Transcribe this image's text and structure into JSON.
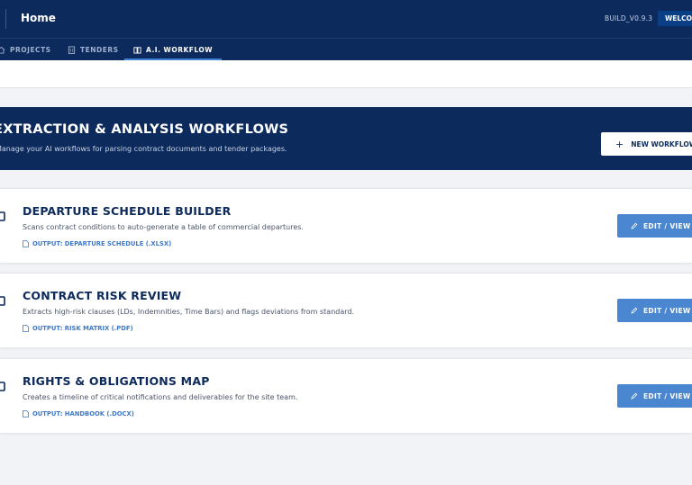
{
  "header": {
    "title": "Home",
    "build": "BUILD_V0.9.3",
    "welcome": "WELCOME"
  },
  "nav": {
    "tabs": [
      {
        "label": "PROJECTS",
        "icon": "home-icon",
        "active": false
      },
      {
        "label": "TENDERS",
        "icon": "building-icon",
        "active": false
      },
      {
        "label": "A.I. WORKFLOW",
        "icon": "book-icon",
        "active": true
      }
    ]
  },
  "hero": {
    "title": "EXTRACTION & ANALYSIS WORKFLOWS",
    "subtitle": "Manage your AI workflows for parsing contract documents and tender packages.",
    "new_button": "NEW WORKFLOW"
  },
  "workflows": [
    {
      "title": "DEPARTURE SCHEDULE BUILDER",
      "description": "Scans contract conditions to auto-generate a table of commercial departures.",
      "output": "OUTPUT: DEPARTURE SCHEDULE (.XLSX)",
      "button": "EDIT / VIEW"
    },
    {
      "title": "CONTRACT RISK REVIEW",
      "description": "Extracts high-risk clauses (LDs, Indemnities, Time Bars) and flags deviations from standard.",
      "output": "OUTPUT: RISK MATRIX (.PDF)",
      "button": "EDIT / VIEW"
    },
    {
      "title": "RIGHTS & OBLIGATIONS MAP",
      "description": "Creates a timeline of critical notifications and deliverables for the site team.",
      "output": "OUTPUT: HANDBOOK (.DOCX)",
      "button": "EDIT / VIEW"
    }
  ],
  "colors": {
    "navy": "#0c2a5b",
    "accent": "#4b86d0",
    "background": "#f1f3f6"
  }
}
